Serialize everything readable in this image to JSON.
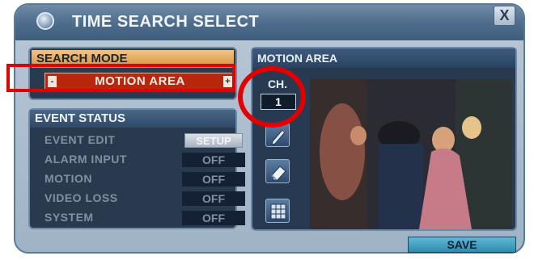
{
  "window": {
    "title": "TIME SEARCH SELECT",
    "close_label": "X"
  },
  "search_mode": {
    "header": "SEARCH MODE",
    "value": "MOTION AREA",
    "left_arrow": "-",
    "right_arrow": "+"
  },
  "event_status": {
    "header": "EVENT STATUS",
    "rows": [
      {
        "label": "EVENT EDIT",
        "value": "SETUP"
      },
      {
        "label": "ALARM INPUT",
        "value": "OFF"
      },
      {
        "label": "MOTION",
        "value": "OFF"
      },
      {
        "label": "VIDEO LOSS",
        "value": "OFF"
      },
      {
        "label": "SYSTEM",
        "value": "OFF"
      }
    ]
  },
  "motion_area": {
    "header": "MOTION AREA",
    "channel_label": "CH.",
    "channel_value": "1",
    "tools": [
      "pencil-icon",
      "eraser-icon",
      "grid-icon"
    ]
  },
  "footer": {
    "save_label": "SAVE"
  },
  "colors": {
    "highlight": "#e30000",
    "mode_bg": "#b8260c",
    "panel_bg": "#2a3a4e",
    "save_bg": "#2e8bb0"
  }
}
